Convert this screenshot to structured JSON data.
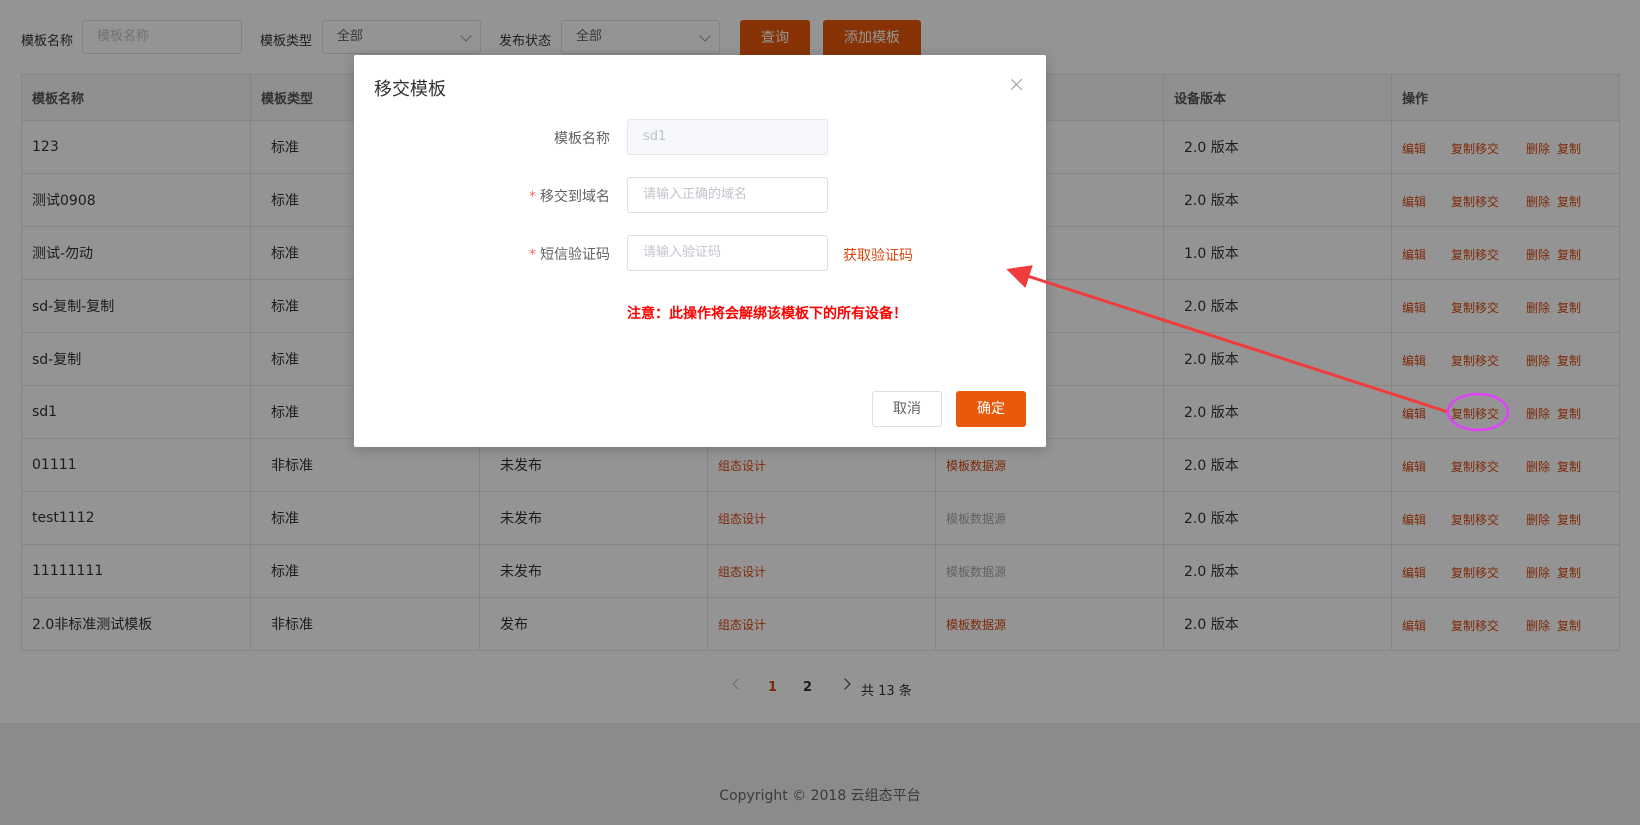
{
  "filters": {
    "name_label": "模板名称",
    "name_placeholder": "模板名称",
    "type_label": "模板类型",
    "type_value": "全部",
    "status_label": "发布状态",
    "status_value": "全部",
    "query_button": "查询",
    "add_button": "添加模板"
  },
  "table": {
    "headers": [
      "模板名称",
      "模板类型",
      "",
      "",
      "",
      "设备版本",
      "操作"
    ],
    "rows": [
      {
        "name": "123",
        "type": "标准",
        "status": "",
        "design": "",
        "datasource": "",
        "version": "2.0 版本"
      },
      {
        "name": "测试0908",
        "type": "标准",
        "status": "",
        "design": "",
        "datasource": "",
        "version": "2.0 版本"
      },
      {
        "name": "测试-勿动",
        "type": "标准",
        "status": "",
        "design": "",
        "datasource": "",
        "version": "1.0 版本"
      },
      {
        "name": "sd-复制-复制",
        "type": "标准",
        "status": "",
        "design": "",
        "datasource": "",
        "version": "2.0 版本"
      },
      {
        "name": "sd-复制",
        "type": "标准",
        "status": "",
        "design": "",
        "datasource": "",
        "version": "2.0 版本"
      },
      {
        "name": "sd1",
        "type": "标准",
        "status": "",
        "design": "",
        "datasource": "",
        "version": "2.0 版本"
      },
      {
        "name": "01111",
        "type": "非标准",
        "status": "未发布",
        "design": "组态设计",
        "datasource": "模板数据源",
        "version": "2.0 版本"
      },
      {
        "name": "test1112",
        "type": "标准",
        "status": "未发布",
        "design": "组态设计",
        "datasource": "模板数据源",
        "version": "2.0 版本"
      },
      {
        "name": "11111111",
        "type": "标准",
        "status": "未发布",
        "design": "组态设计",
        "datasource": "模板数据源",
        "version": "2.0 版本"
      },
      {
        "name": "2.0非标准测试模板",
        "type": "非标准",
        "status": "发布",
        "design": "组态设计",
        "datasource": "模板数据源",
        "version": "2.0 版本"
      }
    ],
    "ops": {
      "edit": "编辑",
      "copy_transfer": "复制移交",
      "delete": "删除",
      "copy": "复制"
    }
  },
  "pagination": {
    "pages": [
      "1",
      "2"
    ],
    "current": "1",
    "total": "共 13 条"
  },
  "footer": "Copyright © 2018 云组态平台",
  "dialog": {
    "title": "移交模板",
    "name_label": "模板名称",
    "name_value": "sd1",
    "domain_label": "移交到域名",
    "domain_placeholder": "请输入正确的域名",
    "sms_label": "短信验证码",
    "sms_placeholder": "请输入验证码",
    "get_code": "获取验证码",
    "warning": "注意：此操作将会解绑该模板下的所有设备！",
    "cancel": "取消",
    "confirm": "确定"
  },
  "colors": {
    "accent": "#e8590c",
    "warning": "#ff0000",
    "annotation_arrow": "#f03c3c",
    "annotation_circle": "#e040fb"
  }
}
